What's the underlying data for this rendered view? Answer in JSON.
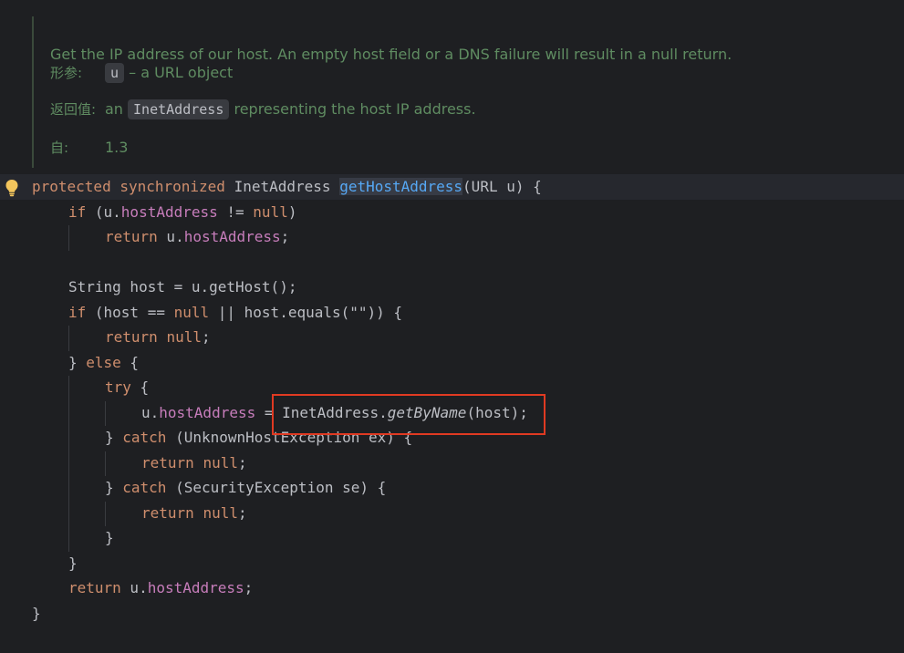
{
  "javadoc": {
    "description": "Get the IP address of our host. An empty host field or a DNS failure will result in a null return.",
    "param_label": "形参:",
    "param_name": "u",
    "param_desc": " – a URL object",
    "return_label": "返回值:",
    "return_prefix": "an ",
    "return_type": "InetAddress",
    "return_desc": " representing the host IP address.",
    "since_label": "自:",
    "since_value": "1.3"
  },
  "code": {
    "l1": {
      "kw_protected": "protected",
      "kw_synchronized": "synchronized",
      "type": "InetAddress",
      "method": "getHostAddress",
      "params": "(URL u) {"
    },
    "l2": {
      "kw_if": "if",
      "open": " (u.",
      "field": "hostAddress",
      "op": " != ",
      "kw_null": "null",
      "close": ")"
    },
    "l3": {
      "kw_return": "return",
      "pre": " u.",
      "field": "hostAddress",
      "end": ";"
    },
    "l4": {
      "text": "String host = u.getHost();"
    },
    "l5": {
      "kw_if": "if",
      "a": " (host == ",
      "kw_null": "null",
      "b": " || host.equals(\"\")) {"
    },
    "l6": {
      "kw_return": "return",
      "kw_null": "null",
      "end": ";"
    },
    "l7": {
      "pre": "} ",
      "kw_else": "else",
      "post": " {"
    },
    "l8": {
      "kw_try": "try",
      "post": " {"
    },
    "l9": {
      "pre": "u.",
      "field": "hostAddress",
      "mid": " = InetAddress.",
      "method": "getByName",
      "post": "(host);"
    },
    "l10": {
      "pre": "} ",
      "kw_catch": "catch",
      "post": " (UnknownHostException ex) {"
    },
    "l11": {
      "kw_return": "return",
      "kw_null": "null",
      "end": ";"
    },
    "l12": {
      "pre": "} ",
      "kw_catch": "catch",
      "post": " (SecurityException se) {"
    },
    "l13": {
      "kw_return": "return",
      "kw_null": "null",
      "end": ";"
    },
    "l14": {
      "text": "}"
    },
    "l15": {
      "text": "}"
    },
    "l16": {
      "kw_return": "return",
      "pre": " u.",
      "field": "hostAddress",
      "end": ";"
    },
    "l17": {
      "text": "}"
    }
  },
  "gutter": {
    "intention_icon": "lightbulb-icon"
  },
  "colors": {
    "background": "#1e1f22",
    "keyword": "#cf8e6d",
    "field": "#c77dbb",
    "method": "#56a8f5",
    "doc_text": "#5f8c61",
    "annotation_box": "#e03a22"
  }
}
